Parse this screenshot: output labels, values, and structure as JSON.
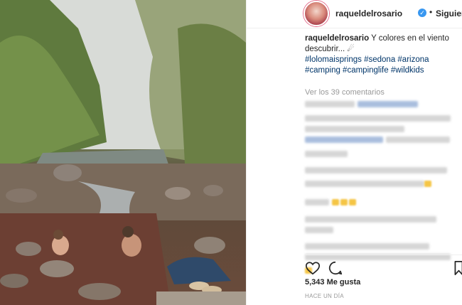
{
  "post": {
    "username": "raqueldelrosario",
    "separator": "•",
    "follow_status": "Siguiendo",
    "caption_text": "Y colores en el viento descubrir...",
    "caption_emoji": "☄",
    "hashtags": "#lolomaisprings #sedona #arizona #camping #campinglife #wildkids",
    "view_comments": "Ver los 39 comentarios",
    "likes": "5,343 Me gusta",
    "timestamp": "HACE UN DÍA"
  },
  "icons": {
    "verified": "verified-badge-icon",
    "like": "heart-icon",
    "comment": "comment-icon",
    "save": "bookmark-icon"
  },
  "colors": {
    "verified_blue": "#3897f0",
    "hashtag_blue": "#003569",
    "muted_text": "#999999"
  }
}
